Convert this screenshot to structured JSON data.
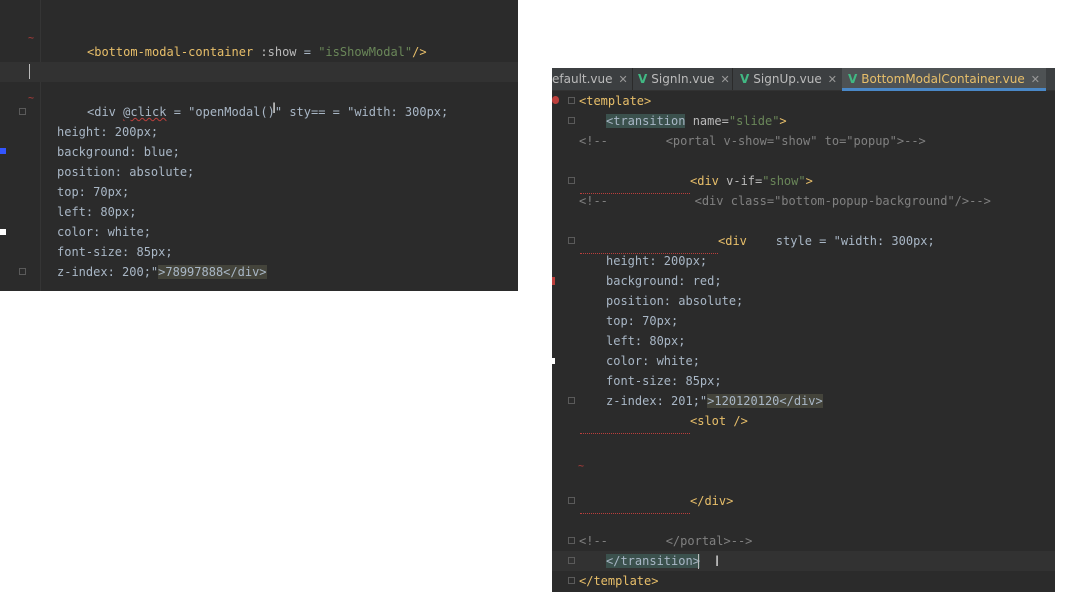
{
  "left_editor": {
    "lines": [
      {
        "indent": "",
        "tokens": [
          {
            "t": "tag",
            "v": "<bottom-modal-container "
          },
          {
            "t": "attr",
            "v": ":show"
          },
          {
            "t": "plain",
            "v": " = "
          },
          {
            "t": "str",
            "v": "\"isShowModal\""
          },
          {
            "t": "tag",
            "v": "/>"
          }
        ]
      },
      {
        "tokens": [
          {
            "t": "plain",
            "v": "<div "
          },
          {
            "t": "squiggle",
            "v": "@click"
          },
          {
            "t": "plain",
            "v": " = \"openModal()\" "
          },
          {
            "t": "plain",
            "v": "sty=="
          },
          {
            "t": "plain",
            "v": " = \"width: 300px;"
          }
        ]
      },
      {
        "tokens": [
          {
            "t": "plain",
            "v": "height: 200px;"
          }
        ]
      },
      {
        "tokens": [
          {
            "t": "plain",
            "v": "background: blue;"
          }
        ]
      },
      {
        "tokens": [
          {
            "t": "plain",
            "v": "position: absolute;"
          }
        ]
      },
      {
        "tokens": [
          {
            "t": "plain",
            "v": "top: 70px;"
          }
        ]
      },
      {
        "tokens": [
          {
            "t": "plain",
            "v": "left: 80px;"
          }
        ]
      },
      {
        "tokens": [
          {
            "t": "plain",
            "v": "color: white;"
          }
        ]
      },
      {
        "tokens": [
          {
            "t": "plain",
            "v": "font-size: 85px;"
          }
        ]
      },
      {
        "tokens": [
          {
            "t": "plain",
            "v": "z-index: 200;\""
          },
          {
            "t": "hlbox",
            "v": ">78997888</div>"
          }
        ]
      }
    ]
  },
  "right_editor": {
    "tabs": [
      {
        "label": "efault.vue",
        "close": "✕",
        "active": false
      },
      {
        "label": "SignIn.vue",
        "close": "✕",
        "active": false
      },
      {
        "label": "SignUp.vue",
        "close": "✕",
        "active": false
      },
      {
        "label": "BottomModalContainer.vue",
        "close": "✕",
        "active": true
      }
    ],
    "lines": [
      {
        "tokens": [
          {
            "t": "tag",
            "v": "<template>"
          }
        ]
      },
      {
        "tokens": [
          {
            "t": "hl",
            "v": "<transition"
          },
          {
            "t": "attr",
            "v": " name="
          },
          {
            "t": "str",
            "v": "\"slide\""
          },
          {
            "t": "tag",
            "v": ">"
          }
        ]
      },
      {
        "tokens": [
          {
            "t": "comment",
            "v": "<!--        <portal v-show=\"show\" to=\"popup\">-->"
          }
        ]
      },
      {
        "tokens": []
      },
      {
        "tokens": [
          {
            "t": "tag",
            "v": "<div "
          },
          {
            "t": "attr",
            "v": "v-if="
          },
          {
            "t": "str",
            "v": "\"show\""
          },
          {
            "t": "tag",
            "v": ">"
          }
        ]
      },
      {
        "tokens": [
          {
            "t": "comment",
            "v": "<!--            <div class=\"bottom-popup-background\"/>-->"
          }
        ]
      },
      {
        "tokens": []
      },
      {
        "tokens": [
          {
            "t": "tag",
            "v": "<div"
          },
          {
            "t": "plain",
            "v": "    style = \"width: 300px;"
          }
        ]
      },
      {
        "tokens": [
          {
            "t": "plain",
            "v": "height: 200px;"
          }
        ]
      },
      {
        "tokens": [
          {
            "t": "plain",
            "v": "background: red;"
          }
        ]
      },
      {
        "tokens": [
          {
            "t": "plain",
            "v": "position: absolute;"
          }
        ]
      },
      {
        "tokens": [
          {
            "t": "plain",
            "v": "top: 70px;"
          }
        ]
      },
      {
        "tokens": [
          {
            "t": "plain",
            "v": "left: 80px;"
          }
        ]
      },
      {
        "tokens": [
          {
            "t": "plain",
            "v": "color: white;"
          }
        ]
      },
      {
        "tokens": [
          {
            "t": "plain",
            "v": "font-size: 85px;"
          }
        ]
      },
      {
        "tokens": [
          {
            "t": "plain",
            "v": "z-index: 201;\""
          },
          {
            "t": "hlbox",
            "v": ">120120120</div>"
          }
        ]
      },
      {
        "tokens": [
          {
            "t": "tag",
            "v": "<slot />"
          }
        ]
      },
      {
        "tokens": []
      },
      {
        "tokens": []
      },
      {
        "tokens": []
      },
      {
        "tokens": [
          {
            "t": "tag",
            "v": "</div>"
          }
        ]
      },
      {
        "tokens": []
      },
      {
        "tokens": [
          {
            "t": "comment",
            "v": "<!--        </portal>-->"
          }
        ]
      },
      {
        "tokens": [
          {
            "t": "hl",
            "v": "</transition>"
          }
        ]
      },
      {
        "tokens": [
          {
            "t": "tag",
            "v": "</template>"
          }
        ]
      }
    ]
  }
}
